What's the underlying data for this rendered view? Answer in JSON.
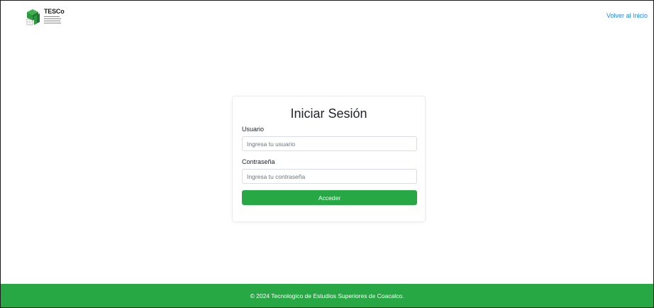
{
  "header": {
    "logo_text": "TESCo",
    "back_link": "Volver al Inicio"
  },
  "login": {
    "title": "Iniciar Sesión",
    "username_label": "Usuario",
    "username_placeholder": "Ingresa tu usuario",
    "password_label": "Contraseña",
    "password_placeholder": "Ingresa tu contraseña",
    "submit_label": "Acceder"
  },
  "footer": {
    "text": "© 2024 Tecnologico de Estudios Superiores de Coacalco."
  },
  "colors": {
    "accent": "#28a745",
    "link": "#1a86ff",
    "logo_green": "#2b9a3e"
  },
  "icons": {
    "logo": "tesco-logo-icon"
  }
}
